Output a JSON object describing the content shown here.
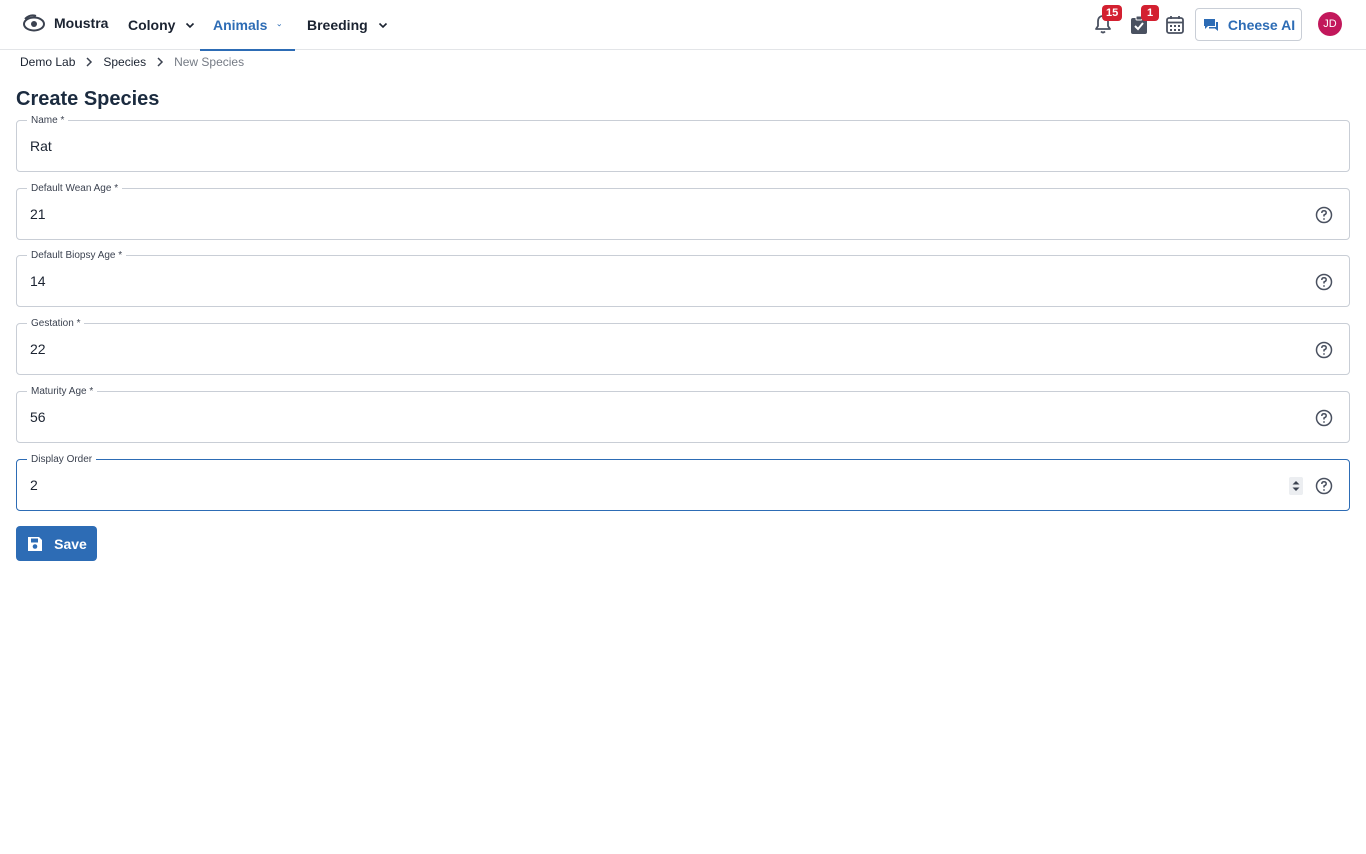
{
  "app": {
    "name": "Moustra"
  },
  "nav": [
    {
      "label": "Colony",
      "active": false
    },
    {
      "label": "Animals",
      "active": true
    },
    {
      "label": "Breeding",
      "active": false
    }
  ],
  "header": {
    "notifications_count": "15",
    "tasks_count": "1",
    "ai_label": "Cheese AI",
    "avatar_initials": "JD"
  },
  "breadcrumb": [
    {
      "label": "Demo Lab"
    },
    {
      "label": "Species"
    },
    {
      "label": "New Species"
    }
  ],
  "page": {
    "title": "Create Species"
  },
  "form": {
    "fields": [
      {
        "label": "Name *",
        "value": "Rat"
      },
      {
        "label": "Default Wean Age *",
        "value": "21"
      },
      {
        "label": "Default Biopsy Age *",
        "value": "14"
      },
      {
        "label": "Gestation *",
        "value": "22"
      },
      {
        "label": "Maturity Age *",
        "value": "56"
      },
      {
        "label": "Display Order",
        "value": "2"
      }
    ],
    "save_label": "Save"
  },
  "colors": {
    "accent": "#2d6cb5",
    "badge": "#d32030",
    "avatar": "#c2185b"
  },
  "icons": [
    "logo-icon",
    "chevron-down-icon",
    "bell-icon",
    "task-check-icon",
    "calendar-icon",
    "chat-icon",
    "help-circle-icon",
    "chevron-right-icon",
    "save-floppy-icon",
    "spinner-arrows-icon"
  ]
}
